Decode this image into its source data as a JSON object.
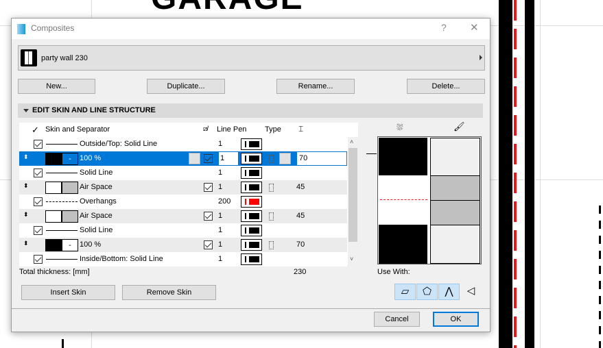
{
  "background": {
    "heading": "GARAGE",
    "accent_red": "#e8141e"
  },
  "dialog": {
    "title": "Composites",
    "help": "?",
    "close": "✕",
    "selected_composite": "party wall 230",
    "buttons": {
      "new": "New...",
      "duplicate": "Duplicate...",
      "rename": "Rename...",
      "delete": "Delete..."
    },
    "section_title": "EDIT SKIN AND LINE STRUCTURE",
    "table": {
      "headers": {
        "skin": "Skin and Separator",
        "line_pen": "Line Pen",
        "type": "Type"
      },
      "rows": [
        {
          "kind": "line",
          "checked": true,
          "line": "solid",
          "label": "Outside/Top: Solid Line",
          "pen": "1",
          "pen_color": "#000000"
        },
        {
          "kind": "skin",
          "selected": true,
          "fill": "#000000",
          "bg": "-",
          "label": "100 %",
          "vis": true,
          "pen": "1",
          "pen_color": "#000000",
          "thickness": "70"
        },
        {
          "kind": "line",
          "checked": true,
          "line": "solid",
          "label": "Solid Line",
          "pen": "1",
          "pen_color": "#000000"
        },
        {
          "kind": "skin",
          "fill": "#ffffff",
          "bg": "#c0c0c0",
          "label": "Air Space",
          "vis": true,
          "pen": "1",
          "pen_color": "#000000",
          "thickness": "45"
        },
        {
          "kind": "line",
          "checked": true,
          "line": "dashed",
          "label": "Overhangs",
          "pen": "200",
          "pen_color": "#ff0000"
        },
        {
          "kind": "skin",
          "fill": "#ffffff",
          "bg": "#c0c0c0",
          "label": "Air Space",
          "vis": true,
          "pen": "1",
          "pen_color": "#000000",
          "thickness": "45"
        },
        {
          "kind": "line",
          "checked": true,
          "line": "solid",
          "label": "Solid Line",
          "pen": "1",
          "pen_color": "#000000"
        },
        {
          "kind": "skin",
          "fill": "#000000",
          "bg": "-",
          "label": "100 %",
          "vis": true,
          "pen": "1",
          "pen_color": "#000000",
          "thickness": "70"
        },
        {
          "kind": "line",
          "checked": true,
          "line": "solid",
          "label": "Inside/Bottom: Solid Line",
          "pen": "1",
          "pen_color": "#000000"
        }
      ]
    },
    "total_label": "Total thickness: [mm]",
    "total_value": "230",
    "insert_skin": "Insert Skin",
    "remove_skin": "Remove Skin",
    "use_with_label": "Use With:",
    "use_with": [
      {
        "icon": "wall-icon",
        "active": true
      },
      {
        "icon": "slab-icon",
        "active": true
      },
      {
        "icon": "roof-icon",
        "active": true
      },
      {
        "icon": "shell-icon",
        "active": false
      }
    ],
    "cancel": "Cancel",
    "ok": "OK",
    "selection_color": "#0078d7"
  }
}
